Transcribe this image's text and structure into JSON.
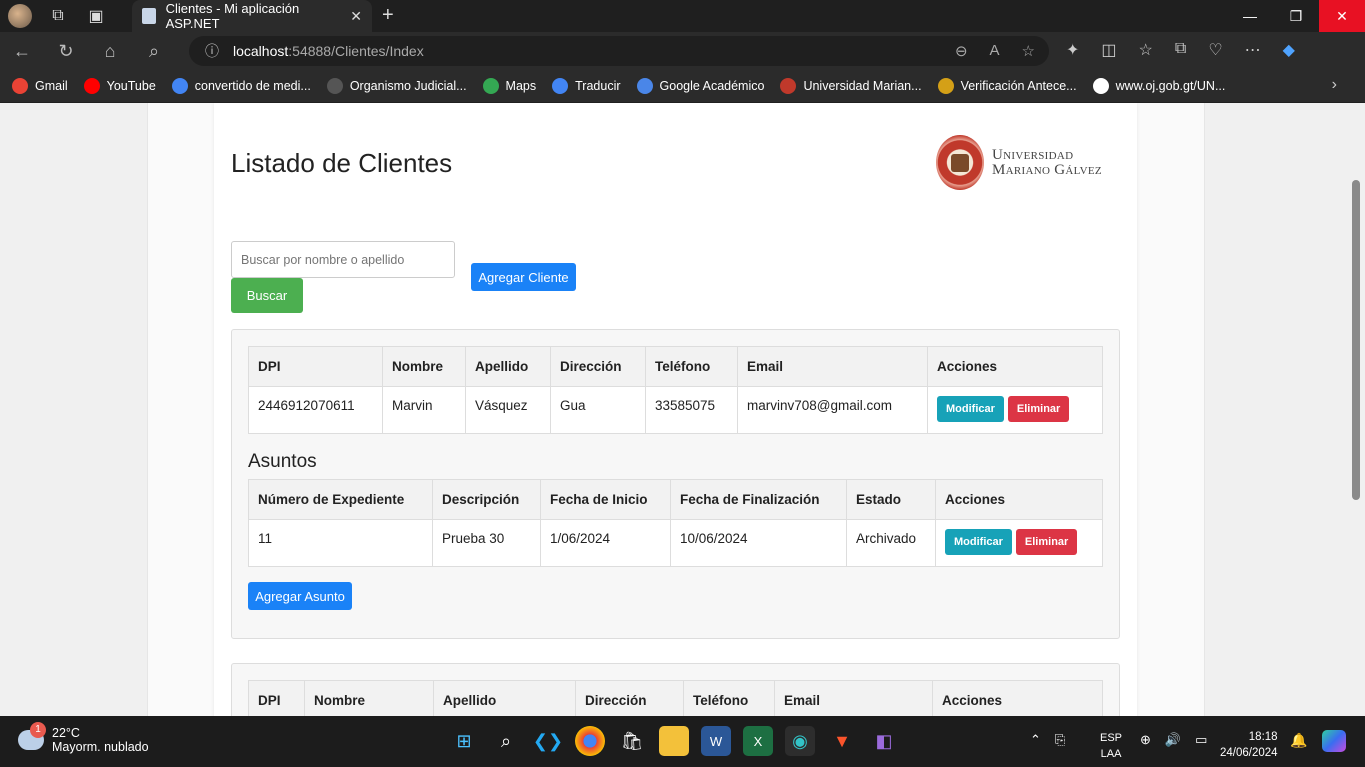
{
  "browser": {
    "tab_title": "Clientes - Mi aplicación ASP.NET",
    "url_host": "localhost",
    "url_rest": ":54888/Clientes/Index",
    "bookmarks": [
      {
        "label": "Gmail",
        "color": "#ea4335"
      },
      {
        "label": "YouTube",
        "color": "#ff0000"
      },
      {
        "label": "convertido de medi...",
        "color": "#4285f4"
      },
      {
        "label": "Organismo Judicial...",
        "color": "#555555"
      },
      {
        "label": "Maps",
        "color": "#34a853"
      },
      {
        "label": "Traducir",
        "color": "#4285f4"
      },
      {
        "label": "Google Académico",
        "color": "#4a86e8"
      },
      {
        "label": "Universidad Marian...",
        "color": "#c0392b"
      },
      {
        "label": "Verificación Antece...",
        "color": "#d4a017"
      },
      {
        "label": "www.oj.gob.gt/UN...",
        "color": "#ffffff"
      }
    ]
  },
  "page": {
    "title": "Listado de Clientes",
    "logo_line1": "Universidad",
    "logo_line2": "Mariano Gálvez",
    "search_placeholder": "Buscar por nombre o apellido",
    "search_button": "Buscar",
    "add_client_button": "Agregar Cliente"
  },
  "clients_table": {
    "headers": [
      "DPI",
      "Nombre",
      "Apellido",
      "Dirección",
      "Teléfono",
      "Email",
      "Acciones"
    ],
    "rows": [
      {
        "dpi": "2446912070611",
        "nombre": "Marvin",
        "apellido": "Vásquez",
        "direccion": "Gua",
        "telefono": "33585075",
        "email": "marvinv708@gmail.com"
      }
    ],
    "modify_label": "Modificar",
    "delete_label": "Eliminar"
  },
  "asuntos": {
    "heading": "Asuntos",
    "headers": [
      "Número de Expediente",
      "Descripción",
      "Fecha de Inicio",
      "Fecha de Finalización",
      "Estado",
      "Acciones"
    ],
    "rows": [
      {
        "expediente": "11",
        "descripcion": "Prueba 30",
        "inicio": "1/06/2024",
        "fin": "10/06/2024",
        "estado": "Archivado"
      }
    ],
    "add_button": "Agregar Asunto"
  },
  "taskbar": {
    "temp": "22°C",
    "weather": "Mayorm. nublado",
    "weather_badge": "1",
    "lang1": "ESP",
    "lang2": "LAA",
    "time": "18:18",
    "date": "24/06/2024"
  }
}
